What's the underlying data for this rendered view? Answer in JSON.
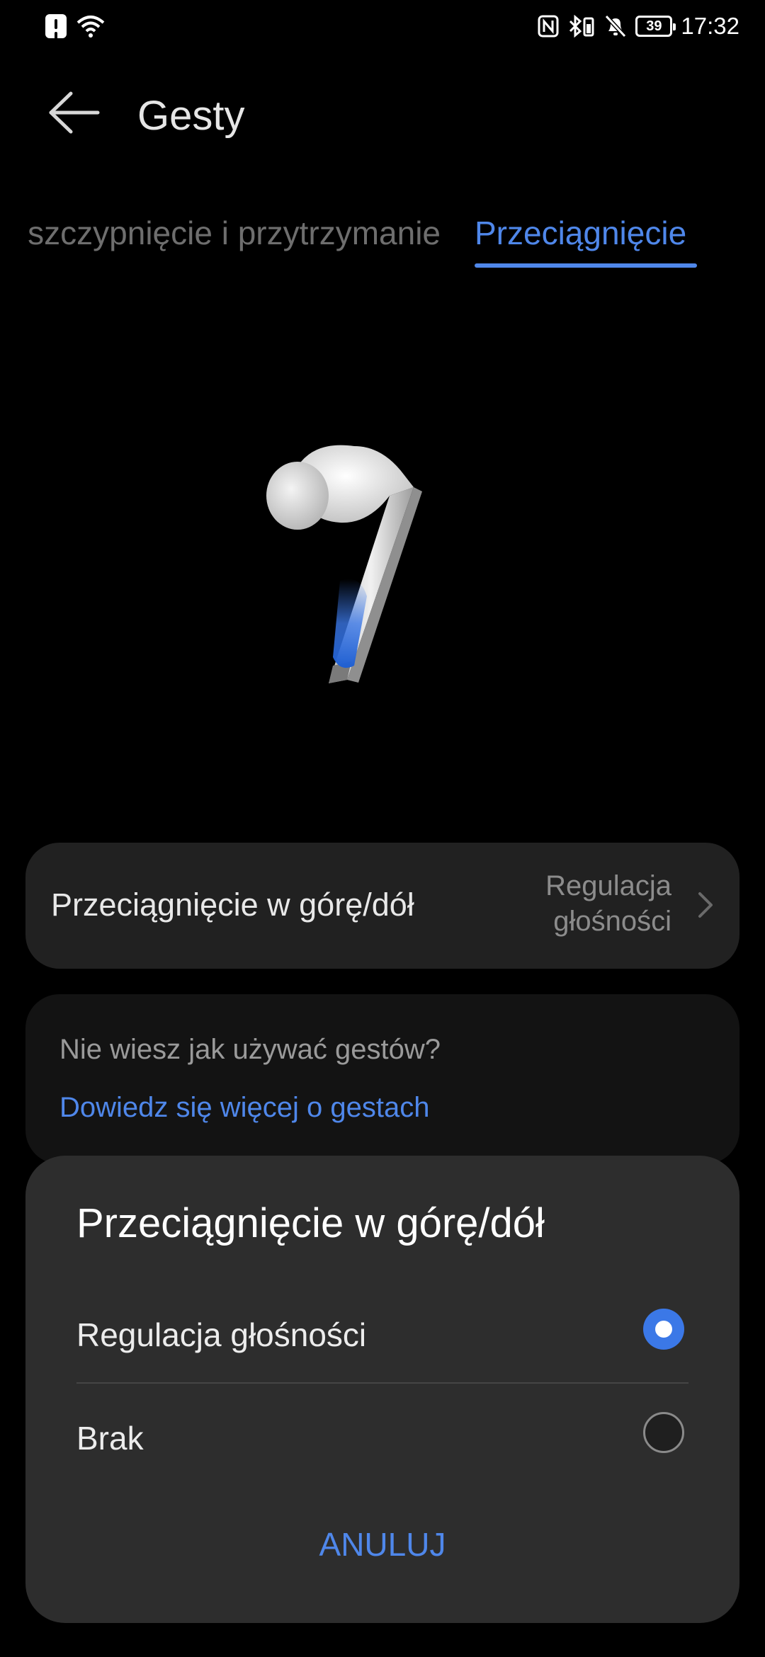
{
  "status_bar": {
    "time": "17:32",
    "battery": "39",
    "icons_left": [
      "alert-icon",
      "wifi-icon"
    ],
    "icons_right": [
      "nfc-icon",
      "bluetooth-battery-icon",
      "mute-icon",
      "battery-icon"
    ]
  },
  "header": {
    "title": "Gesty",
    "back_icon": "arrow-left-icon"
  },
  "tabs": [
    {
      "label": "szczypnięcie i przytrzymanie",
      "active": false
    },
    {
      "label": "Przeciągnięcie",
      "active": true
    }
  ],
  "accent_color": "#4f87ea",
  "setting": {
    "label": "Przeciągnięcie w górę/dół",
    "value_line1": "Regulacja",
    "value_line2": "głośności"
  },
  "help": {
    "question": "Nie wiesz jak używać gestów?",
    "link": "Dowiedz się więcej o gestach"
  },
  "dialog": {
    "title": "Przeciągnięcie w górę/dół",
    "options": [
      {
        "label": "Regulacja głośności",
        "selected": true
      },
      {
        "label": "Brak",
        "selected": false
      }
    ],
    "cancel": "ANULUJ"
  }
}
